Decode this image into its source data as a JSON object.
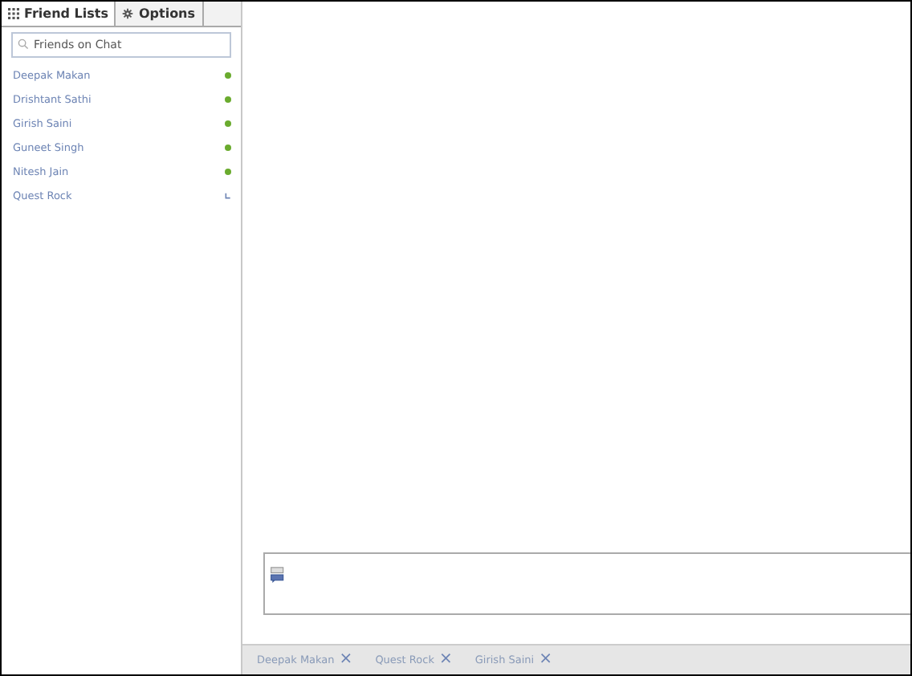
{
  "sidebar": {
    "tabs": [
      {
        "label": "Friend Lists",
        "kind": "grid",
        "selected": true
      },
      {
        "label": "Options",
        "kind": "gear",
        "selected": false
      }
    ],
    "search": {
      "placeholder": "Friends on Chat"
    },
    "friends": [
      {
        "name": "Deepak Makan",
        "kind": "online"
      },
      {
        "name": "Drishtant Sathi",
        "kind": "online"
      },
      {
        "name": "Girish Saini",
        "kind": "online"
      },
      {
        "name": "Guneet Singh",
        "kind": "online"
      },
      {
        "name": "Nitesh Jain",
        "kind": "online"
      },
      {
        "name": "Quest Rock",
        "kind": "idle"
      }
    ]
  },
  "chat_tabs": [
    {
      "label": "Deepak Makan",
      "close": "×"
    },
    {
      "label": "Quest Rock",
      "close": "×"
    },
    {
      "label": "Girish Saini",
      "close": "×"
    }
  ]
}
